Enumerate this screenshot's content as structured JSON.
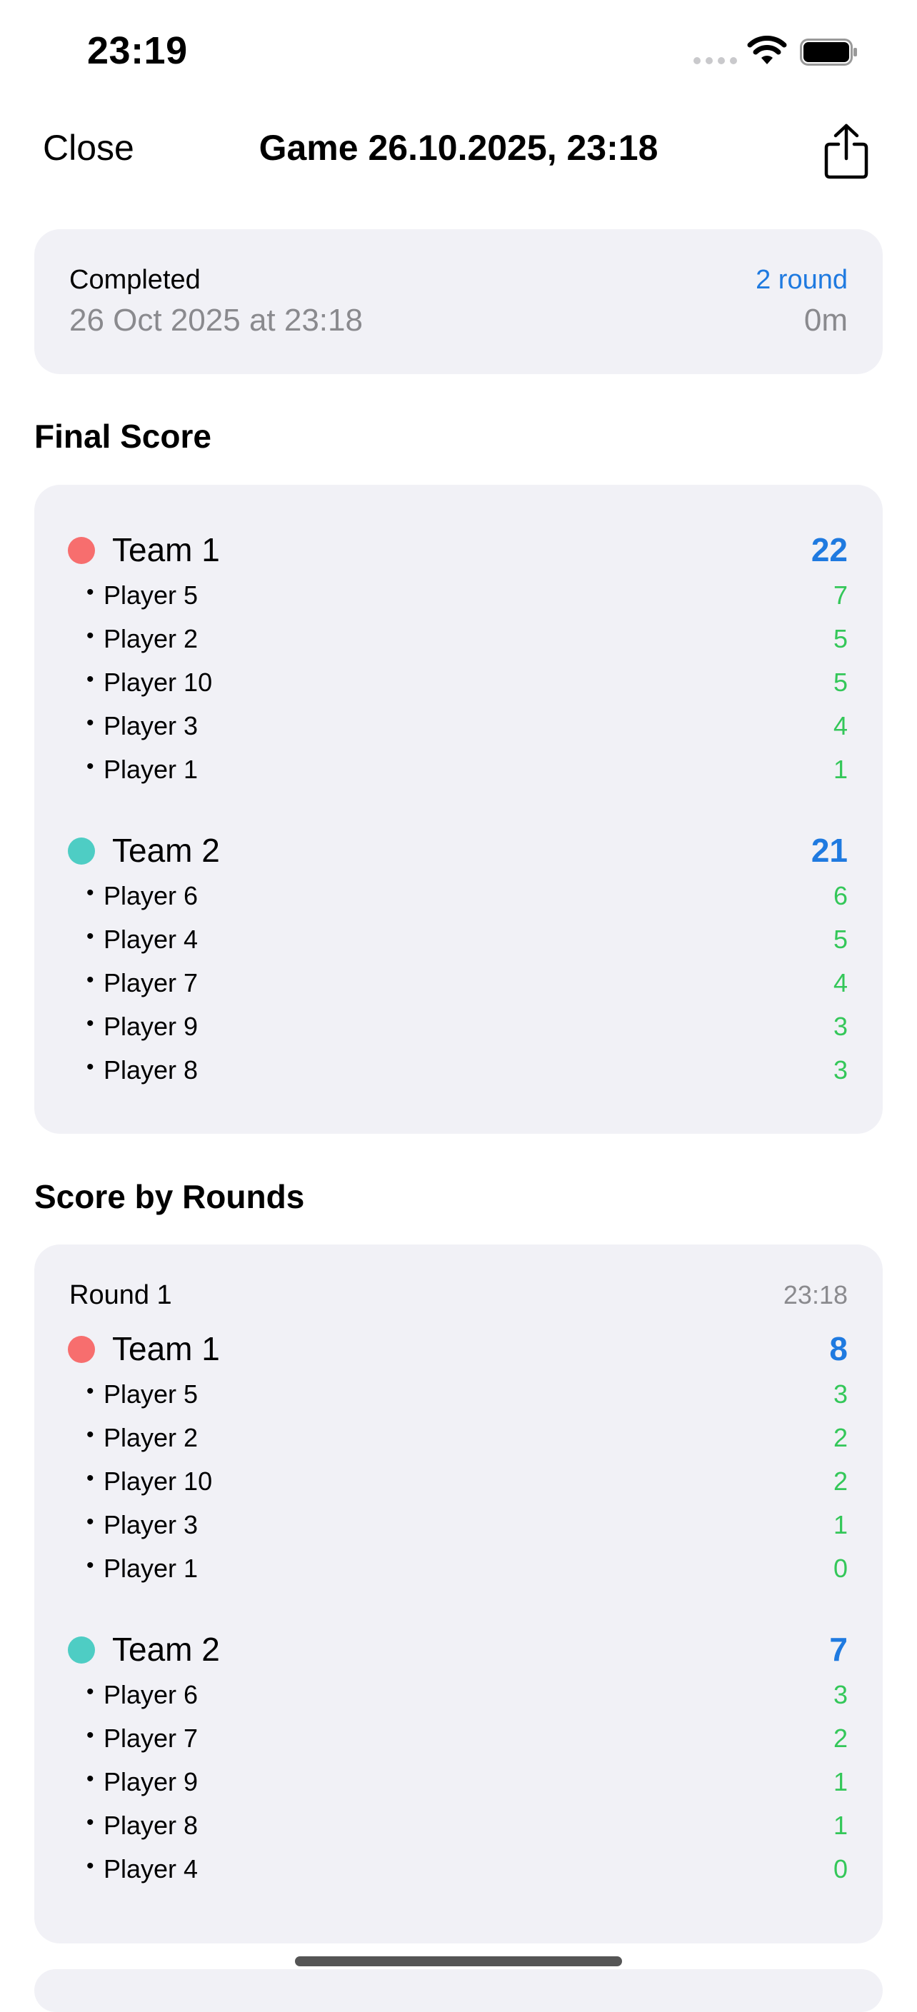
{
  "status_bar": {
    "time": "23:19"
  },
  "nav": {
    "close_label": "Close",
    "title": "Game 26.10.2025, 23:18",
    "share_icon": "share-icon"
  },
  "summary": {
    "status": "Completed",
    "date": "26 Oct 2025 at 23:18",
    "rounds": "2 round",
    "duration": "0m"
  },
  "final_score": {
    "title": "Final Score",
    "teams": [
      {
        "name": "Team 1",
        "color": "#f76e6e",
        "score": "22",
        "players": [
          {
            "name": "Player 5",
            "score": "7"
          },
          {
            "name": "Player 2",
            "score": "5"
          },
          {
            "name": "Player 10",
            "score": "5"
          },
          {
            "name": "Player 3",
            "score": "4"
          },
          {
            "name": "Player 1",
            "score": "1"
          }
        ]
      },
      {
        "name": "Team 2",
        "color": "#4ecdc4",
        "score": "21",
        "players": [
          {
            "name": "Player 6",
            "score": "6"
          },
          {
            "name": "Player 4",
            "score": "5"
          },
          {
            "name": "Player 7",
            "score": "4"
          },
          {
            "name": "Player 9",
            "score": "3"
          },
          {
            "name": "Player 8",
            "score": "3"
          }
        ]
      }
    ]
  },
  "rounds": {
    "title": "Score by Rounds",
    "items": [
      {
        "label": "Round 1",
        "time": "23:18",
        "teams": [
          {
            "name": "Team 1",
            "color": "#f76e6e",
            "score": "8",
            "players": [
              {
                "name": "Player 5",
                "score": "3"
              },
              {
                "name": "Player 2",
                "score": "2"
              },
              {
                "name": "Player 10",
                "score": "2"
              },
              {
                "name": "Player 3",
                "score": "1"
              },
              {
                "name": "Player 1",
                "score": "0"
              }
            ]
          },
          {
            "name": "Team 2",
            "color": "#4ecdc4",
            "score": "7",
            "players": [
              {
                "name": "Player 6",
                "score": "3"
              },
              {
                "name": "Player 7",
                "score": "2"
              },
              {
                "name": "Player 9",
                "score": "1"
              },
              {
                "name": "Player 8",
                "score": "1"
              },
              {
                "name": "Player 4",
                "score": "0"
              }
            ]
          }
        ]
      }
    ]
  }
}
